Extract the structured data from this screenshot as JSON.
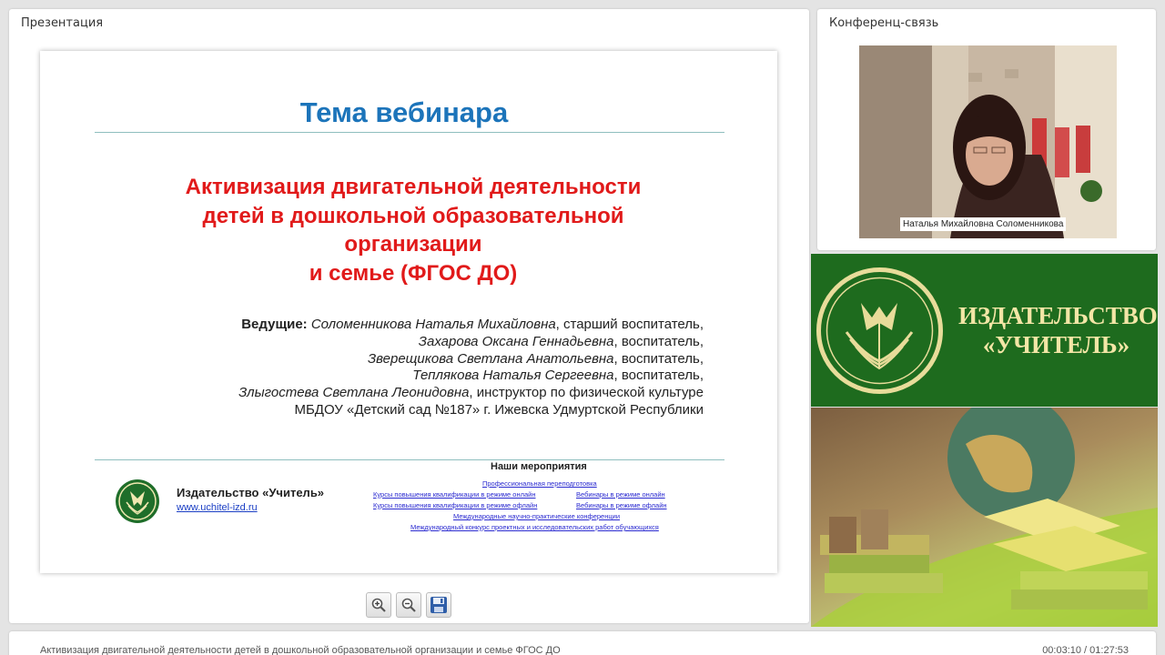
{
  "presentation": {
    "panel_title": "Презентация",
    "slide": {
      "title": "Тема вебинара",
      "topic_lines": [
        "Активизация двигательной деятельности",
        "детей в дошкольной образовательной",
        "организации",
        "и семье (ФГОС ДО)"
      ],
      "leaders_label": "Ведущие:",
      "leaders": [
        {
          "name": "Соломенникова Наталья Михайловна",
          "role": ", старший воспитатель,"
        },
        {
          "name": "Захарова Оксана Геннадьевна",
          "role": ", воспитатель,"
        },
        {
          "name": "Зверещикова Светлана Анатольевна",
          "role": ", воспитатель,"
        },
        {
          "name": "Теплякова Наталья Сергеевна",
          "role": ", воспитатель,"
        },
        {
          "name": "Злыгостева Светлана Леонидовна",
          "role": ", инструктор по физической культуре"
        }
      ],
      "organization": "МБДОУ «Детский сад №187» г. Ижевска Удмуртской Республики",
      "publisher_name": "Издательство «Учитель»",
      "publisher_url": "www.uchitel-izd.ru",
      "events_title": "Наши мероприятия",
      "events": {
        "prof": "Профессиональная переподготовка",
        "courses_online": "Курсы повышения квалификации в режиме онлайн",
        "webinars_online": "Вебинары в режиме онлайн",
        "courses_offline": "Курсы повышения квалификации в режиме офлайн",
        "webinars_offline": "Вебинары в режиме офлайн",
        "conferences": "Международные научно-практические конференции",
        "contest": "Международный конкурс проектных и исследовательских работ обучающихся"
      }
    },
    "toolbar": {
      "zoom_in_icon": "zoom-in-icon",
      "zoom_out_icon": "zoom-out-icon",
      "save_icon": "floppy-disk-icon"
    }
  },
  "conference": {
    "panel_title": "Конференц-связь",
    "speaker_name": "Наталья Михайловна Соломенникова"
  },
  "brand": {
    "line1": "ИЗДАТЕЛЬСТВО",
    "line2": "«УЧИТЕЛЬ»"
  },
  "footer": {
    "title": "Активизация двигательной деятельности детей в дошкольной образовательной организации и семье ФГОС ДО",
    "time": "00:03:10 / 01:27:53"
  },
  "colors": {
    "title_blue": "#1c74ba",
    "topic_red": "#e11a1a",
    "brand_green": "#1e6b1e",
    "brand_text": "#f3e6a6"
  }
}
